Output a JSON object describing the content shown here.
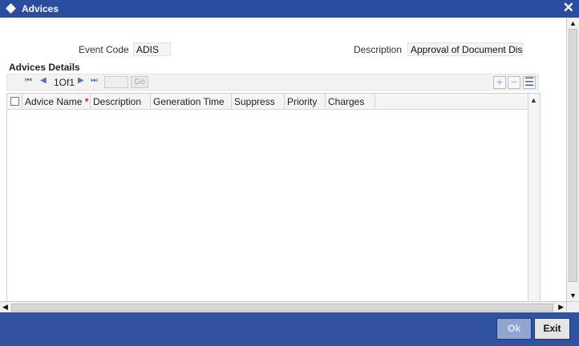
{
  "window": {
    "title": "Advices",
    "close_glyph": "✕"
  },
  "form": {
    "event_code_label": "Event Code",
    "event_code_value": "ADIS",
    "description_label": "Description",
    "description_value": "Approval of Document Discr"
  },
  "section": {
    "title": "Advices Details"
  },
  "navigation": {
    "first_glyph": "⏮",
    "prev_glyph": "◀",
    "pager_text": "1Of1",
    "next_glyph": "▶",
    "last_glyph": "⏭",
    "page_input": "",
    "go_label": "Go",
    "add_glyph": "+",
    "remove_glyph": "−",
    "view_glyph": "☰"
  },
  "table": {
    "columns": [
      "Advice Name",
      "Description",
      "Generation Time",
      "Suppress",
      "Priority",
      "Charges"
    ],
    "required_marker": "*",
    "rows": []
  },
  "footer": {
    "ok_label": "Ok",
    "exit_label": "Exit"
  },
  "colors": {
    "titlebar": "#2a4da0",
    "footer": "#30529f",
    "ok_disabled": "#8fa4cf",
    "exit": "#e4e4e4",
    "required": "#dd2222"
  },
  "icons": {
    "title": "diamond-icon",
    "close": "close-icon",
    "first": "first-page-icon",
    "prev": "prev-page-icon",
    "next": "next-page-icon",
    "last": "last-page-icon",
    "add": "add-row-icon",
    "remove": "remove-row-icon",
    "view": "single-view-icon"
  }
}
